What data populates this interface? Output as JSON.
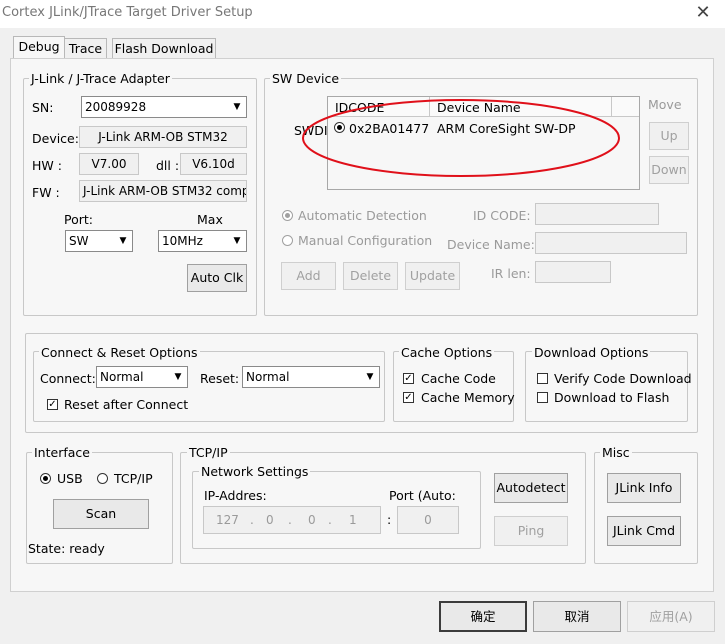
{
  "window": {
    "title": "Cortex JLink/JTrace Target Driver Setup",
    "close_glyph": "✕"
  },
  "tabs": [
    {
      "label": "Debug",
      "active": true
    },
    {
      "label": "Trace",
      "active": false
    },
    {
      "label": "Flash Download",
      "active": false
    }
  ],
  "adapter": {
    "title": "J-Link / J-Trace Adapter",
    "sn_label": "SN:",
    "sn_value": "20089928",
    "device_label": "Device:",
    "device_value": "J-Link ARM-OB STM32",
    "hw_label": "HW :",
    "hw_value": "V7.00",
    "dll_label": "dll :",
    "dll_value": "V6.10d",
    "fw_label": "FW :",
    "fw_value": "J-Link ARM-OB STM32 comp",
    "port_label": "Port:",
    "port_value": "SW",
    "max_label": "Max",
    "max_value": "10MHz",
    "auto_clk": "Auto Clk"
  },
  "sw_device": {
    "title": "SW Device",
    "col_idcode": "IDCODE",
    "col_device_name": "Device Name",
    "row_label": "SWDI",
    "row_idcode": "0x2BA01477",
    "row_device": "ARM CoreSight SW-DP",
    "move_label": "Move",
    "up": "Up",
    "down": "Down",
    "automatic": "Automatic Detection",
    "manual": "Manual Configuration",
    "id_code_label": "ID CODE:",
    "device_name_label": "Device Name:",
    "ir_len_label": "IR len:",
    "add": "Add",
    "delete": "Delete",
    "update": "Update",
    "annotation_color": "#e0101a"
  },
  "connect_reset": {
    "title": "Connect & Reset Options",
    "connect_label": "Connect:",
    "connect_value": "Normal",
    "reset_label": "Reset:",
    "reset_value": "Normal",
    "reset_after_connect": "Reset after Connect",
    "reset_after_connect_checked": true
  },
  "cache": {
    "title": "Cache Options",
    "cache_code": "Cache Code",
    "cache_code_checked": true,
    "cache_memory": "Cache Memory",
    "cache_memory_checked": true
  },
  "download": {
    "title": "Download Options",
    "verify": "Verify Code Download",
    "verify_checked": false,
    "to_flash": "Download to Flash",
    "to_flash_checked": false
  },
  "interface": {
    "title": "Interface",
    "usb": "USB",
    "tcpip": "TCP/IP",
    "selected": "USB",
    "scan": "Scan",
    "state": "State: ready"
  },
  "tcpip": {
    "title": "TCP/IP",
    "network_settings": "Network Settings",
    "ip_label": "IP-Addres:",
    "port_label": "Port (Auto:",
    "ip": [
      "127",
      "0",
      "0",
      "1"
    ],
    "dot": ".",
    "colon": ":",
    "port_value": "0",
    "autodetect": "Autodetect",
    "ping": "Ping"
  },
  "misc": {
    "title": "Misc",
    "jlink_info": "JLink Info",
    "jlink_cmd": "JLink Cmd"
  },
  "footer": {
    "ok": "确定",
    "cancel": "取消",
    "apply": "应用(A)"
  },
  "icons": {
    "dropdown_arrow": "▼",
    "check": "✓"
  }
}
